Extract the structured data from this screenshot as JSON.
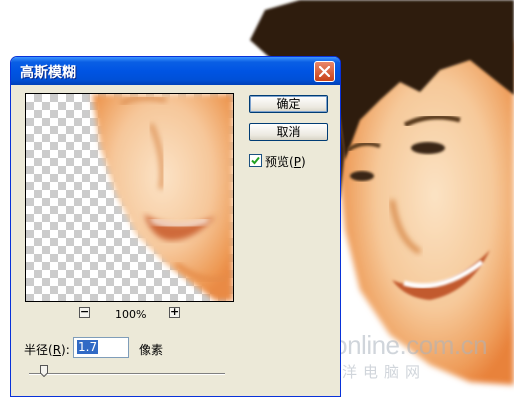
{
  "dialog": {
    "title": "高斯模糊",
    "ok_label": "确定",
    "cancel_label": "取消",
    "preview_label": "预览(",
    "preview_hotkey": "P",
    "preview_suffix": ")",
    "preview_checked": true,
    "zoom_out_label": "−",
    "zoom_in_label": "+",
    "zoom_level": "100%",
    "radius_label_prefix": "半径(",
    "radius_hotkey": "R",
    "radius_label_suffix": "):",
    "radius_value": "1.7",
    "radius_unit": "像素",
    "slider_value": 1.7
  },
  "watermark": {
    "main": "PConline.com.cn",
    "sub": "太平洋电脑网"
  },
  "colors": {
    "title_bar": "#0054e3",
    "dialog_bg": "#ece9d8",
    "close_button": "#c84218",
    "checkbox_mark": "#21a121"
  },
  "icons": {
    "close": "close-icon",
    "check": "check-icon",
    "slider": "slider-thumb-icon"
  }
}
